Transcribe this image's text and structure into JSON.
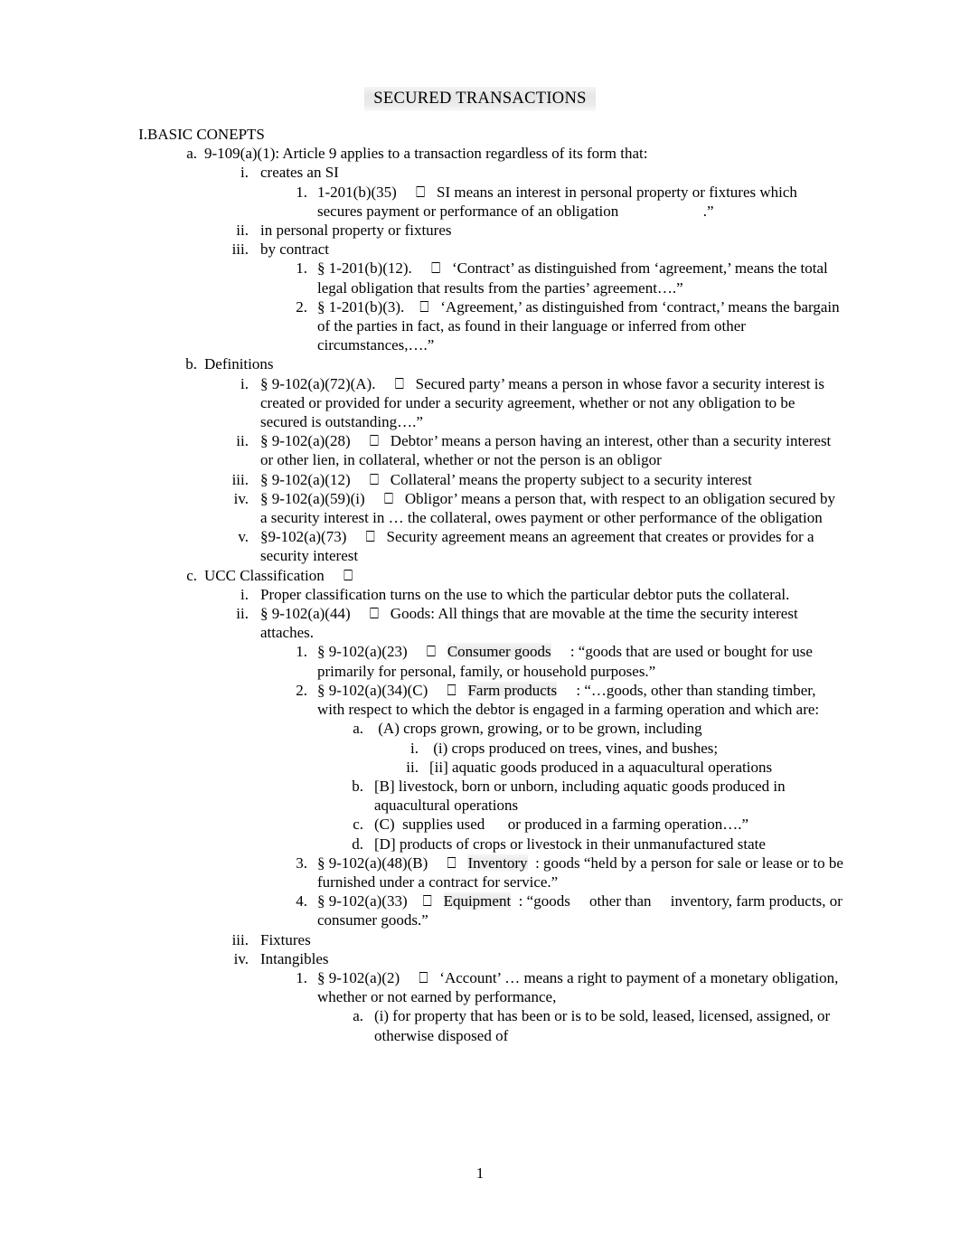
{
  "document": {
    "title": "SECURED TRANSACTIONS",
    "page_number": "1",
    "missing_glyph": "⎕"
  },
  "outline": [
    {
      "level": 1,
      "marker": "I.",
      "text": "BASIC CONEPTS"
    },
    {
      "level": 2,
      "marker": "a.",
      "text": "9-109(a)(1): Article 9 applies to a transaction regardless of its form that:"
    },
    {
      "level": 3,
      "marker": "i.",
      "text": "creates an SI"
    },
    {
      "level": 4,
      "marker": "1.",
      "text": "1-201(b)(35)     ⎕   SI means an interest in personal property or fixtures which secures payment or performance of an obligation                      .”"
    },
    {
      "level": 3,
      "marker": "ii.",
      "text": "in personal property or fixtures"
    },
    {
      "level": 3,
      "marker": "iii.",
      "text": "by contract"
    },
    {
      "level": 4,
      "marker": "1.",
      "text": "§ 1-201(b)(12).     ⎕   ‘Contract’ as distinguished from ‘agreement,’ means the total legal obligation that results from the parties’ agreement….”"
    },
    {
      "level": 4,
      "marker": "2.",
      "text": "§ 1-201(b)(3).    ⎕   ‘Agreement,’ as distinguished from ‘contract,’ means the bargain of the parties in fact, as found in their language or inferred from other circumstances,….”"
    },
    {
      "level": 2,
      "marker": "b.",
      "text": "Definitions"
    },
    {
      "level": 3,
      "marker": "i.",
      "text": "§ 9-102(a)(72)(A).     ⎕   Secured party’ means a person in whose favor a security interest is created or provided for under a security agreement, whether or not any obligation to be secured is outstanding….”"
    },
    {
      "level": 3,
      "marker": "ii.",
      "text": "§ 9-102(a)(28)     ⎕   Debtor’ means a person having an interest, other than a security interest or other lien, in collateral, whether or not the person is an obligor"
    },
    {
      "level": 3,
      "marker": "iii.",
      "text": "§ 9-102(a)(12)     ⎕   Collateral’ means the property subject to a security interest"
    },
    {
      "level": 3,
      "marker": "iv.",
      "text": "§ 9-102(a)(59)(i)     ⎕   Obligor’ means a person that, with respect to an obligation secured by a security interest in … the collateral, owes payment or other performance of the obligation"
    },
    {
      "level": 3,
      "marker": "v.",
      "text": "§9-102(a)(73)     ⎕   Security agreement means an agreement that creates or provides for a security interest"
    },
    {
      "level": 2,
      "marker": "c.",
      "text": "UCC Classification     ⎕"
    },
    {
      "level": 3,
      "marker": "i.",
      "text": "Proper classification turns on the use to which the particular debtor puts the collateral."
    },
    {
      "level": 3,
      "marker": "ii.",
      "text": "§ 9-102(a)(44)     ⎕   Goods: All things that are movable at the time the security interest attaches."
    },
    {
      "level": 4,
      "marker": "1.",
      "pre": "§ 9-102(a)(23)     ⎕   ",
      "highlight": "Consumer goods",
      "post": "     : “goods that are used or bought for use primarily for personal, family, or household purposes.”"
    },
    {
      "level": 4,
      "marker": "2.",
      "pre": "§ 9-102(a)(34)(C)     ⎕   ",
      "highlight": "Farm products",
      "post": "     : “…goods, other than standing timber, with respect to which the debtor is engaged in a farming operation and which are:"
    },
    {
      "level": 5,
      "marker": "a.",
      "text": " (A) crops grown, growing, or to be grown, including"
    },
    {
      "level": 6,
      "marker": "i.",
      "text": " (i) crops produced on trees, vines, and bushes;"
    },
    {
      "level": 6,
      "marker": "ii.",
      "text": "[ii] aquatic goods produced in a aquacultural operations"
    },
    {
      "level": 5,
      "marker": "b.",
      "text": "[B] livestock, born or unborn, including aquatic goods produced in aquacultural operations"
    },
    {
      "level": 5,
      "marker": "c.",
      "text": "(C)  supplies used      or produced in a farming operation….”"
    },
    {
      "level": 5,
      "marker": "d.",
      "text": "[D] products of crops or livestock in their unmanufactured state"
    },
    {
      "level": 4,
      "marker": "3.",
      "pre": "§ 9-102(a)(48)(B)     ⎕   ",
      "highlight": "Inventory",
      "post": "  : goods “held by a person for sale or lease or to be furnished under a contract for service.”"
    },
    {
      "level": 4,
      "marker": "4.",
      "pre": "§ 9-102(a)(33)    ⎕   ",
      "highlight": "Equipment",
      "post": "  : “goods     other than     inventory, farm products, or consumer goods.”"
    },
    {
      "level": 3,
      "marker": "iii.",
      "text": "Fixtures"
    },
    {
      "level": 3,
      "marker": "iv.",
      "text": "Intangibles"
    },
    {
      "level": 4,
      "marker": "1.",
      "text": "§ 9-102(a)(2)     ⎕   ‘Account’ … means a right to payment of a monetary obligation, whether or not earned by performance,"
    },
    {
      "level": 5,
      "marker": "a.",
      "text": "(i) for property that has been or is to be sold, leased, licensed, assigned, or otherwise disposed of"
    }
  ]
}
